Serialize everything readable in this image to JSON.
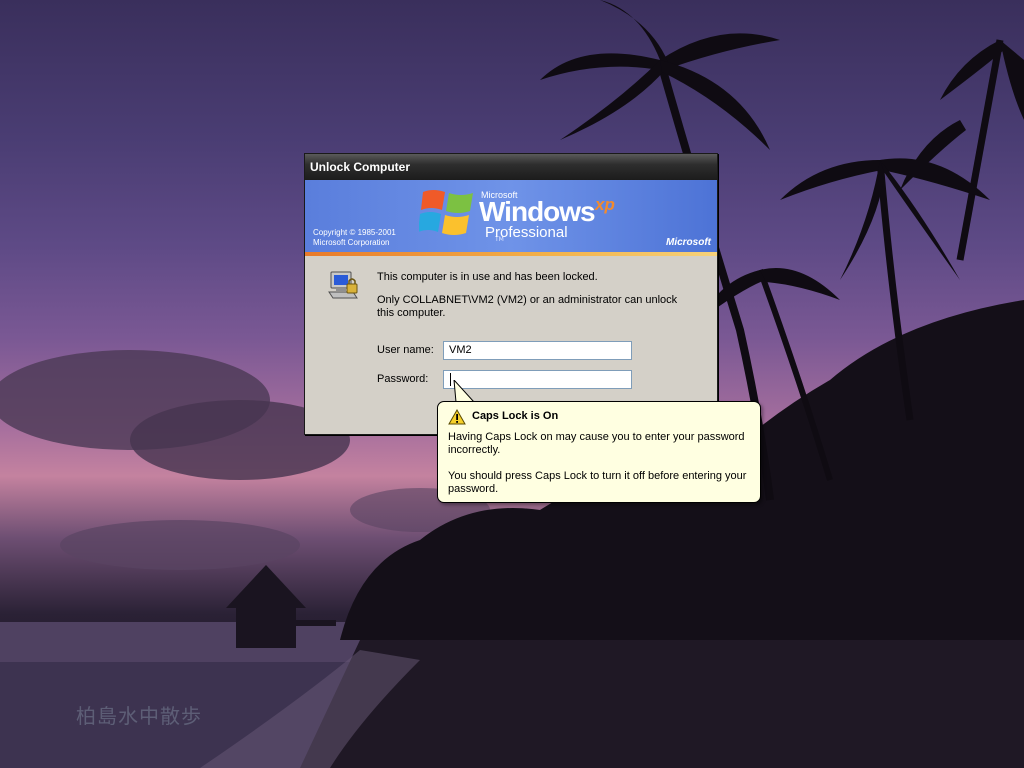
{
  "dialog": {
    "title": "Unlock Computer",
    "banner": {
      "copyright_line1": "Copyright © 1985-2001",
      "copyright_line2": "Microsoft Corporation",
      "microsoft_small": "Microsoft",
      "windows": "Windows",
      "xp": "xp",
      "edition": "Professional",
      "tm": "TM",
      "microsoft_logo": "Microsoft"
    },
    "lock_message": "This computer is in use and has been locked.",
    "unlock_message": "Only COLLABNET\\VM2 (VM2) or an administrator can unlock this computer.",
    "username_label": "User name:",
    "username_value": "VM2",
    "password_label": "Password:",
    "password_value": ""
  },
  "balloon": {
    "icon": "warning-icon",
    "title": "Caps Lock is On",
    "text1": "Having Caps Lock on may cause you to enter your password incorrectly.",
    "text2": "You should press Caps Lock to turn it off before entering your password."
  },
  "wallpaper": {
    "watermark": "柏島水中散歩"
  },
  "colors": {
    "banner_blue": "#6f93e8",
    "xp_orange": "#f28a2e",
    "balloon_bg": "#ffffe1",
    "dialog_bg": "#d4d0c8"
  }
}
